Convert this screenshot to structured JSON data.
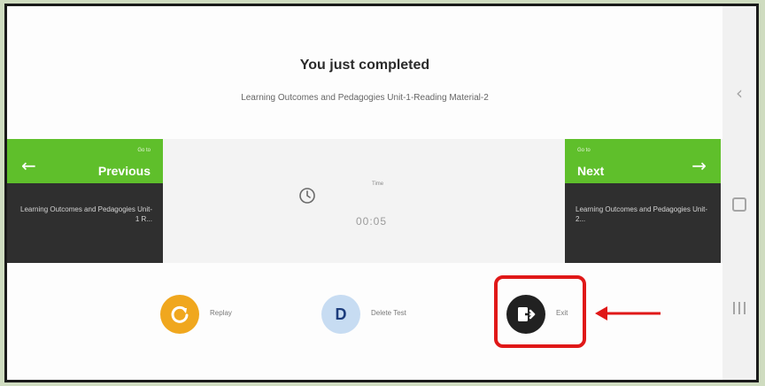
{
  "completion": {
    "heading": "You just completed",
    "content_title": "Learning Outcomes and Pedagogies Unit-1-Reading Material-2"
  },
  "previous": {
    "go_to": "Go to",
    "label": "Previous",
    "item": "Learning Outcomes and Pedagogies Unit-1 R..."
  },
  "next": {
    "go_to": "Go to",
    "label": "Next",
    "item": "Learning Outcomes and Pedagogies Unit-2..."
  },
  "timer": {
    "label": "Time",
    "value": "00:05"
  },
  "actions": {
    "replay_label": "Replay",
    "clear_letter": "D",
    "clear_label": "Delete Test",
    "exit_label": "Exit"
  },
  "android_nav": {
    "back_icon": "back-chevron-icon",
    "home_icon": "home-square-icon",
    "recents_icon": "recents-bars-icon"
  },
  "colors": {
    "green": "#5fbf2b",
    "dark_panel": "#2f2f2f",
    "replay_orange": "#f0a71e",
    "clear_blue": "#c7dcf2",
    "highlight_red": "#e01818"
  }
}
